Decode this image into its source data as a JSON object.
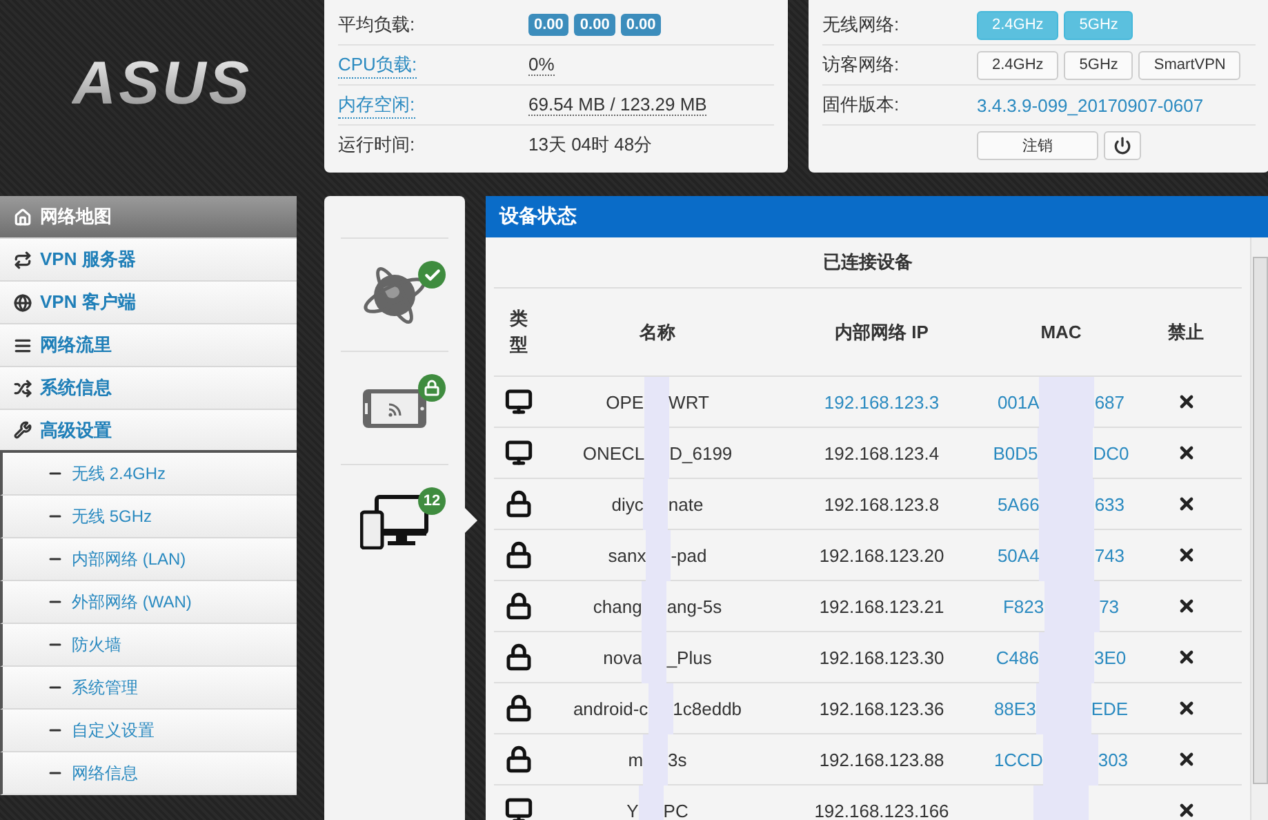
{
  "logo": {
    "text": "ASUS"
  },
  "system_panel": {
    "rows": [
      {
        "label": "平均负载:",
        "link": false,
        "badges": [
          "0.00",
          "0.00",
          "0.00"
        ]
      },
      {
        "label": "CPU负载:",
        "link": true,
        "value": "0%"
      },
      {
        "label": "内存空闲:",
        "link": true,
        "value": "69.54 MB / 123.29 MB"
      },
      {
        "label": "运行时间:",
        "link": false,
        "value": "13天 04时 48分"
      }
    ]
  },
  "network_panel": {
    "rows": [
      {
        "label": "无线网络:",
        "buttons": [
          {
            "label": "2.4GHz",
            "on": true
          },
          {
            "label": "5GHz",
            "on": true
          }
        ]
      },
      {
        "label": "访客网络:",
        "buttons": [
          {
            "label": "2.4GHz",
            "on": false
          },
          {
            "label": "5GHz",
            "on": false
          },
          {
            "label": "SmartVPN",
            "on": false
          }
        ]
      },
      {
        "label": "固件版本:",
        "link_value": "3.4.3.9-099_20170907-0607"
      }
    ],
    "logout": "注销"
  },
  "sidebar": {
    "items": [
      {
        "label": "网络地图",
        "selected": true
      },
      {
        "label": "VPN 服务器",
        "selected": false
      },
      {
        "label": "VPN 客户端",
        "selected": false
      },
      {
        "label": "网络流里",
        "selected": false
      },
      {
        "label": "系统信息",
        "selected": false
      },
      {
        "label": "高级设置",
        "selected": false,
        "expanded": true,
        "children": [
          {
            "label": "无线 2.4GHz",
            "selected": false
          },
          {
            "label": "无线 5GHz",
            "selected": false
          },
          {
            "label": "内部网络 (LAN)",
            "selected": false
          },
          {
            "label": "外部网络 (WAN)",
            "selected": false
          },
          {
            "label": "防火墙",
            "selected": false
          },
          {
            "label": "系统管理",
            "selected": false
          },
          {
            "label": "自定义设置",
            "selected": false
          },
          {
            "label": "网络信息",
            "selected": false
          }
        ]
      }
    ]
  },
  "status_icons": [
    {
      "kind": "internet",
      "badge": {
        "kind": "check"
      },
      "selected": false
    },
    {
      "kind": "wireless",
      "badge": {
        "kind": "lock"
      },
      "selected": false
    },
    {
      "kind": "clients",
      "badge": {
        "kind": "count",
        "text": "12"
      },
      "selected": true
    }
  ],
  "device_panel": {
    "title": "设备状态",
    "subtitle": "已连接设备",
    "columns": [
      "类型",
      "名称",
      "内部网络 IP",
      "MAC",
      "禁止"
    ],
    "rows": [
      {
        "kind": "wired",
        "name_start": "OPE",
        "name_end": "WRT",
        "ip": "192.168.123.3",
        "mac_start": "001A",
        "mac_end": "687"
      },
      {
        "kind": "wired",
        "name_start": "ONECL",
        "name_end": "D_6199",
        "ip": "192.168.123.4",
        "mac_start": "B0D5",
        "mac_end": "DC0"
      },
      {
        "kind": "wireless",
        "name_start": "diyc",
        "name_end": "nate",
        "ip": "192.168.123.8",
        "mac_start": "5A66",
        "mac_end": "633"
      },
      {
        "kind": "wireless",
        "name_start": "sanx",
        "name_end": "-pad",
        "ip": "192.168.123.20",
        "mac_start": "50A4",
        "mac_end": "743"
      },
      {
        "kind": "wireless",
        "name_start": "chang",
        "name_end": "ang-5s",
        "ip": "192.168.123.21",
        "mac_start": "F823",
        "mac_end": "73"
      },
      {
        "kind": "wireless",
        "name_start": "nova",
        "name_end": "_Plus",
        "ip": "192.168.123.30",
        "mac_start": "C486",
        "mac_end": "3E0"
      },
      {
        "kind": "wireless",
        "name_start": "android-c",
        "name_end": "1c8eddb",
        "ip": "192.168.123.36",
        "mac_start": "88E3",
        "mac_end": "EDE"
      },
      {
        "kind": "wireless",
        "name_start": "m",
        "name_end": "3s",
        "ip": "192.168.123.88",
        "mac_start": "1CCD",
        "mac_end": "303"
      },
      {
        "kind": "wired",
        "name_start": "Y",
        "name_end": "PC",
        "ip": "192.168.123.166"
      }
    ]
  }
}
